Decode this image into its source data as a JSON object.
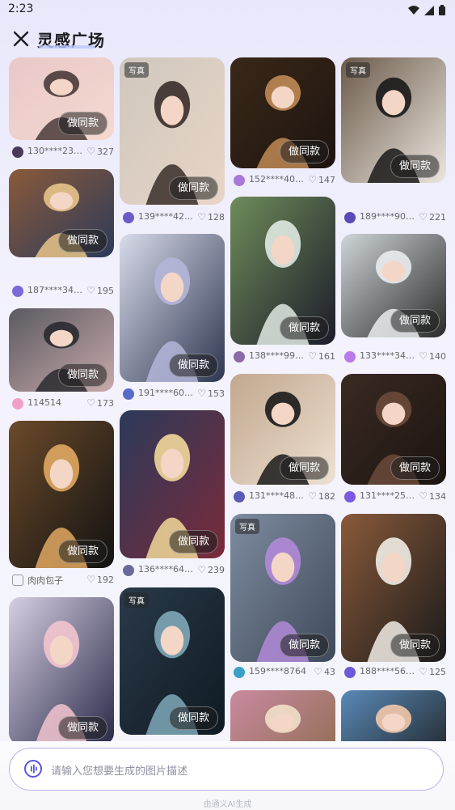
{
  "status": {
    "time": "2:23"
  },
  "header": {
    "title": "灵感广场"
  },
  "common": {
    "make_same_label": "做同款",
    "tag_photo": "写真"
  },
  "feed": [
    {
      "tag": "",
      "user": "130****23…",
      "likes": "327"
    },
    {
      "tag": "写真",
      "user": "139****42…",
      "likes": "128"
    },
    {
      "tag": "",
      "user": "152****40…",
      "likes": "147"
    },
    {
      "tag": "写真",
      "user": "189****90…",
      "likes": "221"
    },
    {
      "tag": "",
      "user": "187****34…",
      "likes": "195"
    },
    {
      "tag": "",
      "user": "191****60…",
      "likes": "153"
    },
    {
      "tag": "",
      "user": "138****99…",
      "likes": "161"
    },
    {
      "tag": "",
      "user": "133****34…",
      "likes": "140"
    },
    {
      "tag": "",
      "user": "114514",
      "likes": "173"
    },
    {
      "tag": "",
      "user": "136****64…",
      "likes": "239"
    },
    {
      "tag": "",
      "user": "131****48…",
      "likes": "182"
    },
    {
      "tag": "",
      "user": "131****25…",
      "likes": "134"
    },
    {
      "tag": "",
      "user": "肉肉包子",
      "likes": "192"
    },
    {
      "tag": "写真",
      "user": "159****8764",
      "likes": "43"
    },
    {
      "tag": "",
      "user": "188****56…",
      "likes": "125"
    },
    {
      "tag": "",
      "user": "",
      "likes": ""
    },
    {
      "tag": "写真",
      "user": "",
      "likes": ""
    },
    {
      "tag": "",
      "user": "",
      "likes": ""
    },
    {
      "tag": "",
      "user": "",
      "likes": ""
    }
  ],
  "prompt": {
    "placeholder": "请输入您想要生成的图片描述"
  },
  "footer": {
    "note": "由通义AI生成"
  }
}
